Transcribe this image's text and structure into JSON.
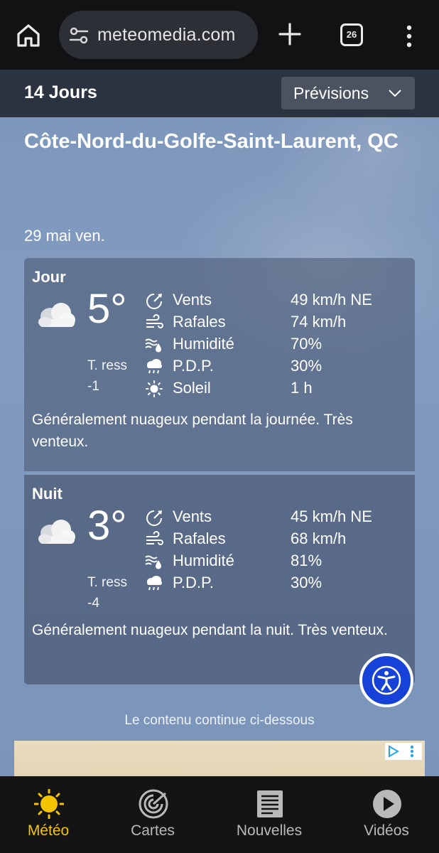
{
  "browser": {
    "url": "meteomedia.com",
    "tab_count": "26"
  },
  "header": {
    "title": "14 Jours",
    "dropdown_label": "Prévisions"
  },
  "location": "Côte-Nord-du-Golfe-Saint-Laurent, QC",
  "date": "29 mai ven.",
  "day": {
    "period": "Jour",
    "temp": "5°",
    "feels_label": "T. ress",
    "feels_value": "-1",
    "metrics": [
      {
        "icon": "wind-icon",
        "name": "Vents",
        "value": "49 km/h NE"
      },
      {
        "icon": "gust-icon",
        "name": "Rafales",
        "value": "74 km/h"
      },
      {
        "icon": "humidity-icon",
        "name": "Humidité",
        "value": "70%"
      },
      {
        "icon": "rain-cloud-icon",
        "name": "P.D.P.",
        "value": "30%"
      },
      {
        "icon": "sun-icon",
        "name": "Soleil",
        "value": "1 h"
      }
    ],
    "description": "Généralement nuageux pendant la journée. Très venteux."
  },
  "night": {
    "period": "Nuit",
    "temp": "3°",
    "feels_label": "T. ress",
    "feels_value": "-4",
    "metrics": [
      {
        "icon": "wind-icon",
        "name": "Vents",
        "value": "45 km/h NE"
      },
      {
        "icon": "gust-icon",
        "name": "Rafales",
        "value": "68 km/h"
      },
      {
        "icon": "humidity-icon",
        "name": "Humidité",
        "value": "81%"
      },
      {
        "icon": "rain-cloud-icon",
        "name": "P.D.P.",
        "value": "30%"
      }
    ],
    "description": "Généralement nuageux pendant la nuit. Très venteux."
  },
  "continue_text": "Le contenu continue ci-dessous",
  "nav": [
    {
      "label": "Météo",
      "icon": "sun-icon",
      "active": true
    },
    {
      "label": "Cartes",
      "icon": "radar-icon",
      "active": false
    },
    {
      "label": "Nouvelles",
      "icon": "news-icon",
      "active": false
    },
    {
      "label": "Vidéos",
      "icon": "play-icon",
      "active": false
    }
  ],
  "colors": {
    "accent": "#f5c400",
    "a11y_button": "#1742d8"
  }
}
